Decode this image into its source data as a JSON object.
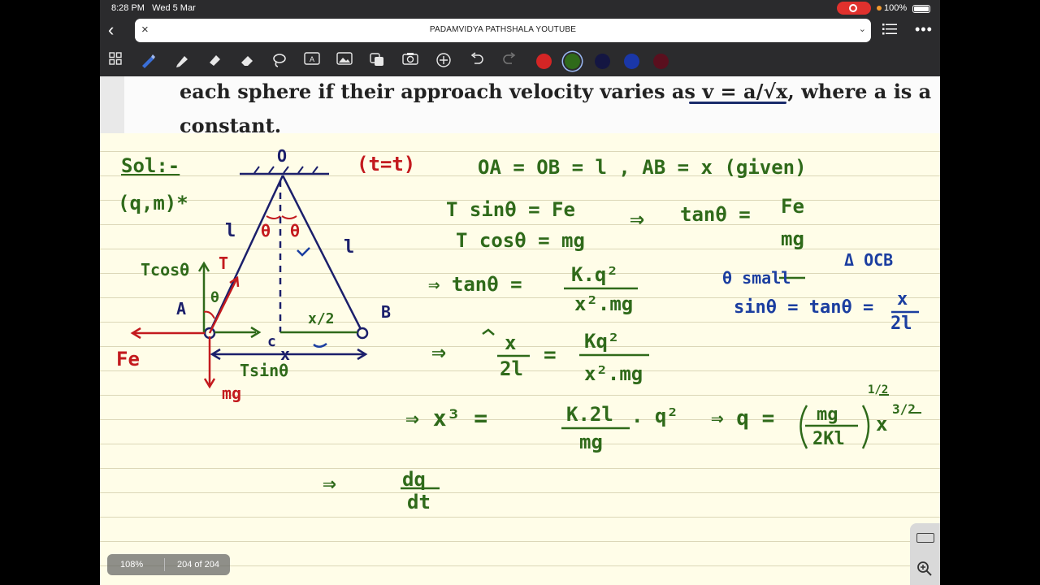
{
  "status": {
    "time": "8:28 PM",
    "date": "Wed 5 Mar",
    "battery": "100%"
  },
  "address": {
    "title": "PADAMVIDYA PATHSHALA YOUTUBE"
  },
  "toolbar": {
    "tools": [
      "grid-icon",
      "pen-icon",
      "highlighter-icon",
      "tape-icon",
      "eraser-icon",
      "lasso-icon",
      "text-box-icon",
      "image-icon",
      "shapes-icon",
      "camera-icon",
      "add-icon",
      "undo-icon",
      "redo-icon"
    ],
    "colors": [
      "#d42525",
      "#2f6a1a",
      "#141642",
      "#1a37a8",
      "#5a0f1e"
    ]
  },
  "printed": {
    "line1_a": "each sphere if their approach velocity varies as ",
    "line1_formula": "v = a/√x",
    "line1_b": ", where a is a",
    "line2": "constant."
  },
  "notes": {
    "sol": "Sol:-",
    "qm": "(q,m)*",
    "point_o": "O",
    "tt": "(t=t)",
    "given": "OA = OB = l  ,  AB = x  (given)",
    "eq1": "T sinθ = Fe",
    "eq2": "T cosθ = mg",
    "implies1": "⇒",
    "tan_eq_num": "Fe",
    "tan_eq_lhs": "tanθ =",
    "tan_eq_den": "mg",
    "triangle": "Δ OCB",
    "theta_small": "θ small",
    "sin_tan": "sinθ = tanθ =",
    "sin_tan_num": "x",
    "sin_tan_den": "2l",
    "tan_coulomb_lhs": "⇒ tanθ =",
    "tan_coulomb_num": "K.q²",
    "tan_coulomb_den": "x².mg",
    "frac_lhs_num": "x",
    "frac_lhs_den": "2l",
    "frac_eq": "=",
    "frac_rhs_num": "Kq²",
    "frac_rhs_den": "x².mg",
    "cube_lhs": "⇒  x³  =",
    "cube_num": "K.2l",
    "cube_den": "mg",
    "cube_tail": ". q²",
    "q_lhs": "⇒  q =",
    "q_num": "mg",
    "q_den": "2Kl",
    "q_pow_half": "1/2",
    "q_x": "x",
    "q_pow": "3/2",
    "dq_num": "dq",
    "dq_den": "dt",
    "label_l1": "l",
    "label_l2": "l",
    "label_theta1": "θ",
    "label_theta2": "θ",
    "label_a": "A",
    "label_b": "B",
    "label_c": "c",
    "label_x2": "x/2",
    "label_x": "x",
    "label_tcos": "Tcosθ",
    "label_tsin": "Tsinθ",
    "label_t": "T",
    "label_theta_a": "θ",
    "label_fe": "Fe",
    "label_mg": "mg"
  },
  "footer": {
    "zoom": "108%",
    "page": "204 of 204"
  }
}
